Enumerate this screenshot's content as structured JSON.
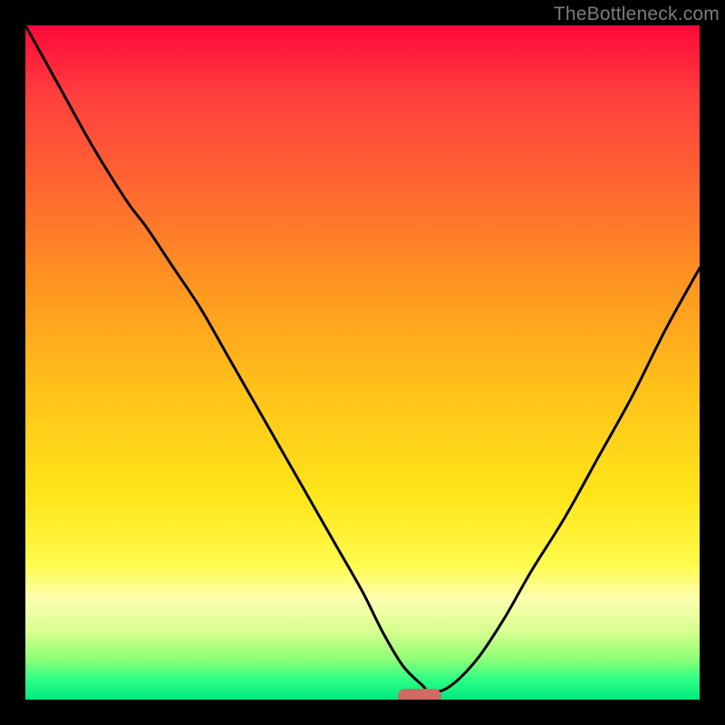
{
  "watermark": "TheBottleneck.com",
  "colors": {
    "frame": "#000000",
    "marker": "#ce6b62",
    "curve": "#000000",
    "watermark": "#7b7b7b"
  },
  "chart_data": {
    "type": "line",
    "title": "",
    "xlabel": "",
    "ylabel": "",
    "xlim": [
      0,
      100
    ],
    "ylim": [
      0,
      100
    ],
    "grid": false,
    "legend": false,
    "series": [
      {
        "name": "bottleneck-curve",
        "x": [
          0,
          5,
          10,
          15,
          18,
          22,
          26,
          30,
          34,
          38,
          42,
          46,
          50,
          53,
          56,
          59,
          60,
          63,
          67,
          71,
          75,
          80,
          85,
          90,
          95,
          100
        ],
        "y": [
          100,
          91,
          82,
          74,
          70,
          64,
          58,
          51,
          44,
          37,
          30,
          23,
          16,
          10,
          5,
          2,
          1,
          2,
          6,
          12,
          19,
          27,
          36,
          45,
          55,
          64
        ]
      }
    ],
    "marker": {
      "x": 58.5,
      "width": 6.5,
      "y": 0.5,
      "height": 2.2
    },
    "gradient_stops": [
      {
        "pos": 0,
        "color": "#ff073a"
      },
      {
        "pos": 10,
        "color": "#ff3e3e"
      },
      {
        "pos": 25,
        "color": "#ff6a2f"
      },
      {
        "pos": 40,
        "color": "#ff9a1f"
      },
      {
        "pos": 55,
        "color": "#ffc41a"
      },
      {
        "pos": 70,
        "color": "#ffe61a"
      },
      {
        "pos": 80,
        "color": "#fffb4d"
      },
      {
        "pos": 85,
        "color": "#fdffb0"
      },
      {
        "pos": 90,
        "color": "#d6ff8e"
      },
      {
        "pos": 94,
        "color": "#8eff78"
      },
      {
        "pos": 97,
        "color": "#2eff85"
      },
      {
        "pos": 100,
        "color": "#00e97f"
      }
    ]
  }
}
